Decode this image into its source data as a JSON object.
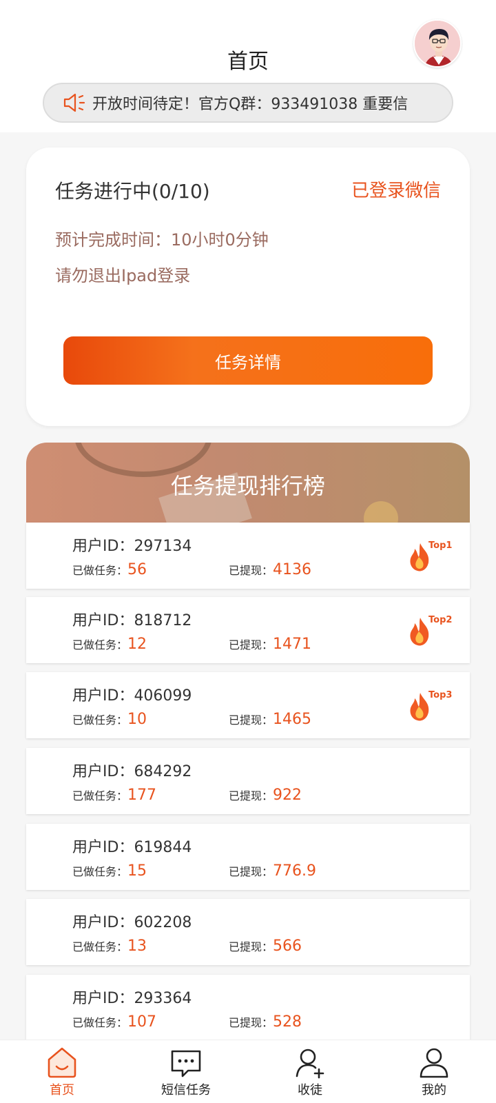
{
  "header": {
    "title": "首页",
    "notice": "开放时间待定！官方Q群：933491038 重要信"
  },
  "task": {
    "title": "任务进行中(0/10)",
    "wechat_status": "已登录微信",
    "eta": "预计完成时间：10小时0分钟",
    "warning": "请勿退出Ipad登录",
    "detail_button": "任务详情"
  },
  "ranking": {
    "title": "任务提现排行榜",
    "uid_prefix": "用户ID：",
    "done_label": "已做任务：",
    "withdraw_label": "已提现：",
    "items": [
      {
        "uid": "297134",
        "done": "56",
        "withdrawn": "4136",
        "badge": "Top1"
      },
      {
        "uid": "818712",
        "done": "12",
        "withdrawn": "1471",
        "badge": "Top2"
      },
      {
        "uid": "406099",
        "done": "10",
        "withdrawn": "1465",
        "badge": "Top3"
      },
      {
        "uid": "684292",
        "done": "177",
        "withdrawn": "922",
        "badge": ""
      },
      {
        "uid": "619844",
        "done": "15",
        "withdrawn": "776.9",
        "badge": ""
      },
      {
        "uid": "602208",
        "done": "13",
        "withdrawn": "566",
        "badge": ""
      },
      {
        "uid": "293364",
        "done": "107",
        "withdrawn": "528",
        "badge": ""
      }
    ]
  },
  "tabbar": {
    "tabs": [
      {
        "label": "首页",
        "icon": "home-icon",
        "active": true
      },
      {
        "label": "短信任务",
        "icon": "message-icon",
        "active": false
      },
      {
        "label": "收徒",
        "icon": "add-user-icon",
        "active": false
      },
      {
        "label": "我的",
        "icon": "profile-icon",
        "active": false
      }
    ]
  },
  "colors": {
    "accent": "#e8531e",
    "muted_text": "#9a6b60"
  }
}
